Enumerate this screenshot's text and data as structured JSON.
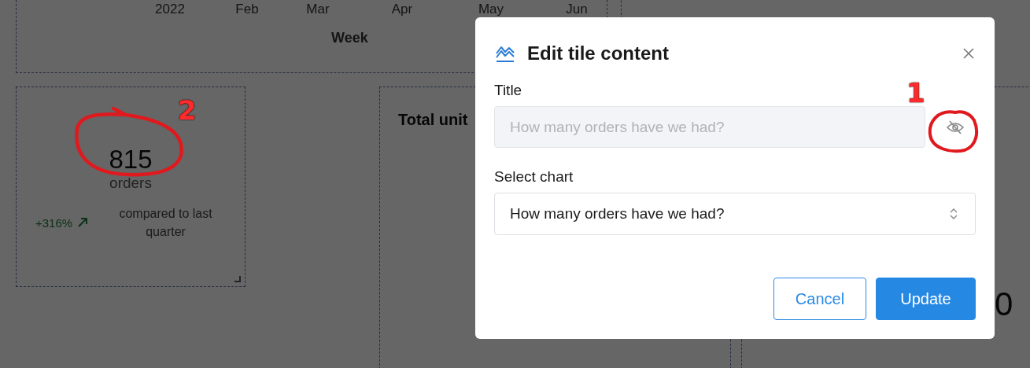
{
  "dashboard": {
    "chart_tile": {
      "x_labels": [
        "2022",
        "Feb",
        "Mar",
        "Apr",
        "May",
        "Jun"
      ],
      "xlabel": "Week"
    },
    "kpi_tile": {
      "value": "815",
      "unit": "orders",
      "change": "+316%",
      "comparison": "compared to last quarter"
    },
    "units_tile": {
      "title": "Total unit"
    },
    "right_tile": {
      "value": "0"
    }
  },
  "dialog": {
    "title": "Edit tile content",
    "title_field": {
      "label": "Title",
      "placeholder": "How many orders have we had?",
      "disabled": true,
      "visible": false
    },
    "chart_select": {
      "label": "Select chart",
      "value": "How many orders have we had?"
    },
    "buttons": [
      {
        "label": "Cancel",
        "kind": "secondary"
      },
      {
        "label": "Update",
        "kind": "primary"
      }
    ]
  },
  "annotations": [
    {
      "label": "1",
      "kind": "circle"
    },
    {
      "label": "2",
      "kind": "loop"
    }
  ]
}
